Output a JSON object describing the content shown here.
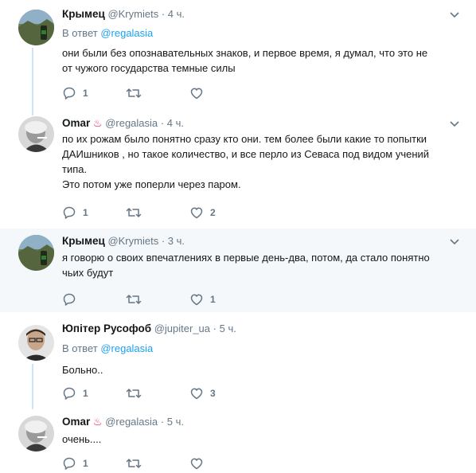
{
  "tweets": [
    {
      "name": "Крымец",
      "handle": "@Krymiets",
      "dot": "·",
      "time": "4 ч.",
      "emoji": "",
      "reply_prefix": "В ответ",
      "reply_to": "@regalasia",
      "text_lines": [
        "они были без опознавательных знаков, и первое время, я думал, что это не",
        "от чужого государства темные силы"
      ],
      "replies": "1",
      "retweets": "",
      "likes": ""
    },
    {
      "name": "Omar",
      "handle": "@regalasia",
      "dot": "·",
      "time": "4 ч.",
      "emoji": "♨",
      "reply_prefix": "",
      "reply_to": "",
      "text_lines": [
        "по их рожам было понятно сразу кто они. тем более были какие то попытки",
        "ДАИшников , но такое количество, и все перло из Севаса под видом учений",
        "типа.",
        "Это потом уже поперли через паром."
      ],
      "replies": "1",
      "retweets": "",
      "likes": "2"
    },
    {
      "name": "Крымец",
      "handle": "@Krymiets",
      "dot": "·",
      "time": "3 ч.",
      "emoji": "",
      "reply_prefix": "",
      "reply_to": "",
      "text_lines": [
        "я говорю о своих впечатлениях в первые день-два, потом, да стало понятно",
        "чьих будут"
      ],
      "replies": "",
      "retweets": "",
      "likes": "1"
    },
    {
      "name": "Юпітер Русофоб",
      "handle": "@jupiter_ua",
      "dot": "·",
      "time": "5 ч.",
      "emoji": "",
      "reply_prefix": "В ответ",
      "reply_to": "@regalasia",
      "text_lines": [
        "Больно.."
      ],
      "replies": "1",
      "retweets": "",
      "likes": "3"
    },
    {
      "name": "Omar",
      "handle": "@regalasia",
      "dot": "·",
      "time": "5 ч.",
      "emoji": "♨",
      "reply_prefix": "",
      "reply_to": "",
      "text_lines": [
        "очень...."
      ],
      "replies": "1",
      "retweets": "",
      "likes": ""
    }
  ],
  "icons": {
    "reply": "reply-icon",
    "retweet": "retweet-icon",
    "like": "heart-icon",
    "menu": "chevron-down-icon"
  },
  "colors": {
    "link": "#1da1f2",
    "secondary": "#657786",
    "thread_line": "#cce4f5",
    "highlight_bg": "#f5f8fa",
    "hot_springs": "#e0245e"
  }
}
